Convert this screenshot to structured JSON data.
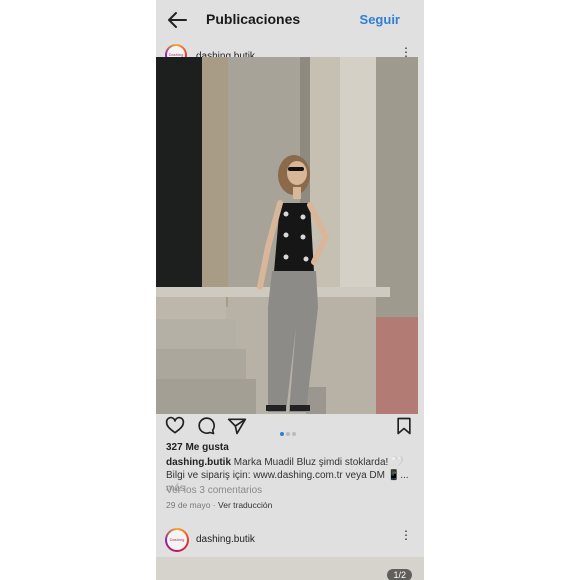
{
  "header": {
    "title": "Publicaciones",
    "follow_label": "Seguir"
  },
  "post": {
    "username": "dashing.butik",
    "likes": "327 Me gusta",
    "caption_user": "dashing.butik",
    "caption_text": "Marka Muadil Bluz şimdi stoklarda! 🤍Bilgi ve sipariş için: www.dashing.com.tr veya DM 📱...",
    "caption_more": "más",
    "comments_link": "Ver los 3 comentarios",
    "date": "29 de mayo",
    "separator": "·",
    "translate": "Ver traducción",
    "carousel_count": 3,
    "carousel_active": 1
  },
  "next_post": {
    "username": "dashing.butik",
    "counter": "1/2"
  },
  "avatar_text": "Dashing",
  "colors": {
    "accent": "#2f7fd8",
    "background": "#e0e0e0"
  },
  "icons": [
    "back-arrow-icon",
    "more-icon",
    "heart-icon",
    "comment-icon",
    "share-icon",
    "bookmark-icon"
  ]
}
